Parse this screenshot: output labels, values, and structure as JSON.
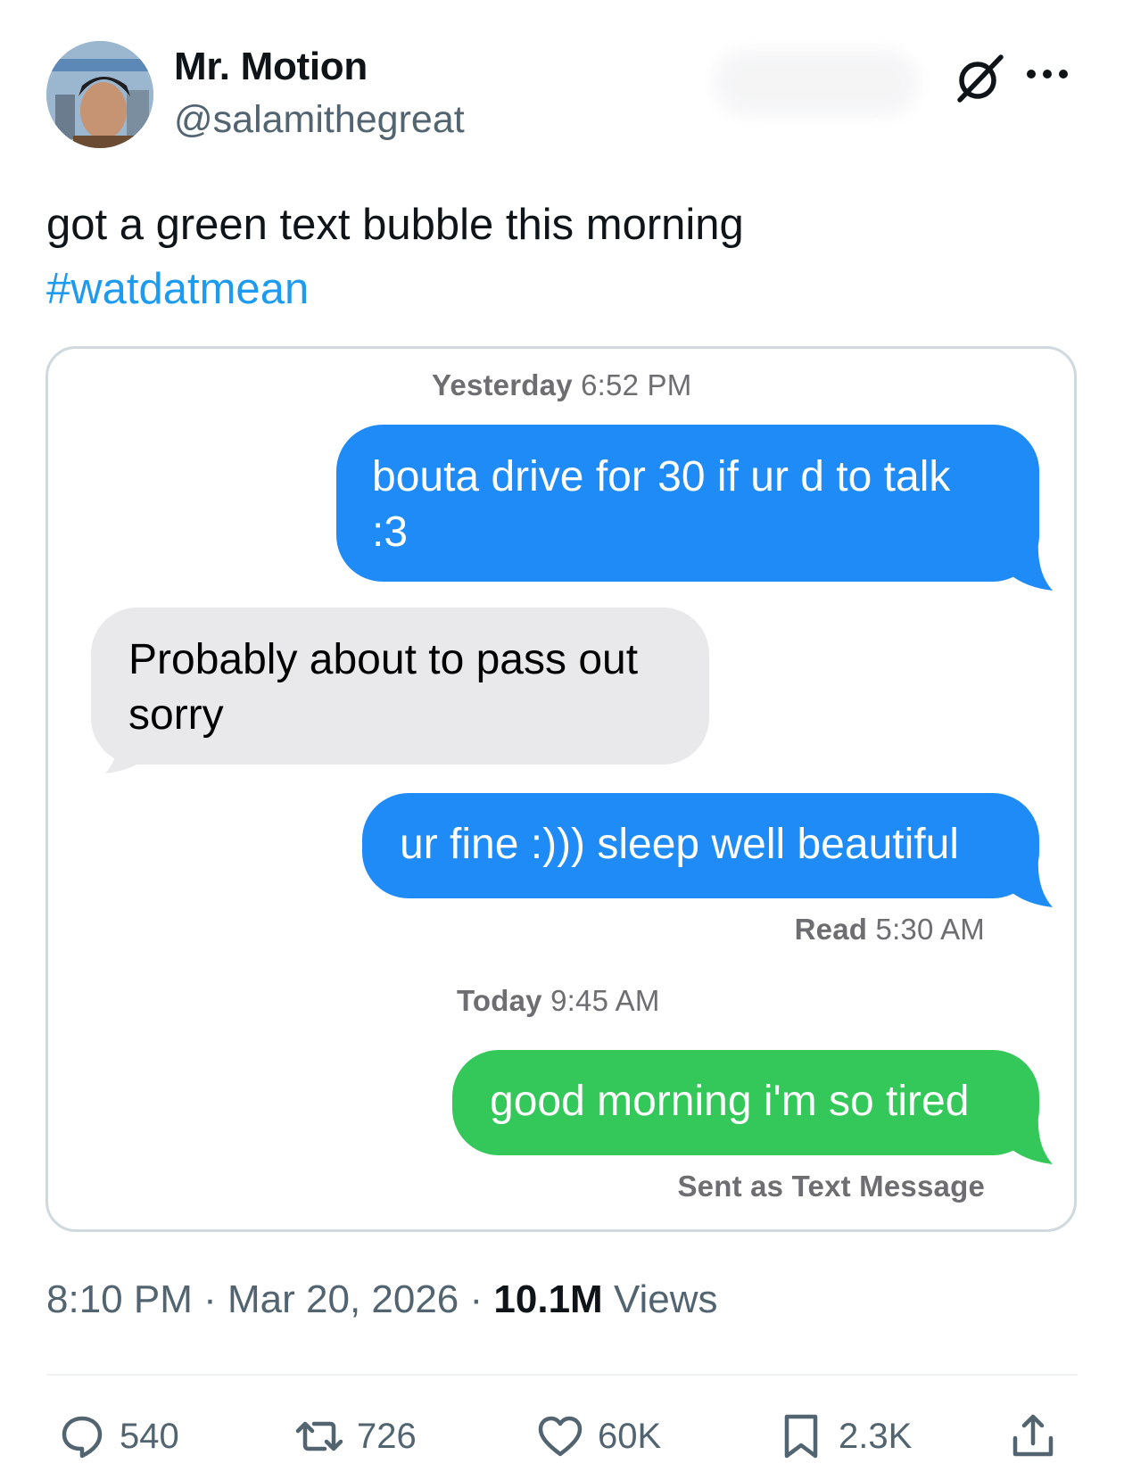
{
  "author": {
    "name": "Mr. Motion",
    "handle": "@salamithegreat"
  },
  "tweet": {
    "text": "got a green text bubble this morning",
    "hashtag": "#watdatmean"
  },
  "conversation": {
    "timestamp_1_day": "Yesterday",
    "timestamp_1_time": "6:52 PM",
    "messages": [
      {
        "from": "me",
        "text_line1": "bouta drive for 30 if ur d to talk",
        "text_line2": ":3"
      },
      {
        "from": "them",
        "text_line1": "Probably about to pass out",
        "text_line2": "sorry"
      },
      {
        "from": "me",
        "text_line1": "ur fine :))) sleep well beautiful"
      },
      {
        "from": "me_sms",
        "text_line1": "good morning i'm so tired"
      }
    ],
    "read_label": "Read",
    "read_time": "5:30 AM",
    "timestamp_2_day": "Today",
    "timestamp_2_time": "9:45 AM",
    "sms_note": "Sent as Text Message"
  },
  "meta": {
    "time": "8:10 PM",
    "separator": "·",
    "date": "Mar 20, 2026",
    "views_count": "10.1M",
    "views_label": "Views"
  },
  "actions": {
    "replies": "540",
    "reposts": "726",
    "likes": "60K",
    "bookmarks": "2.3K"
  },
  "colors": {
    "imessage_blue": "#1e8bf7",
    "sms_green": "#34c759",
    "received_gray": "#e9e9eb",
    "hashtag_blue": "#1d9bf0",
    "secondary_text": "#536471"
  }
}
